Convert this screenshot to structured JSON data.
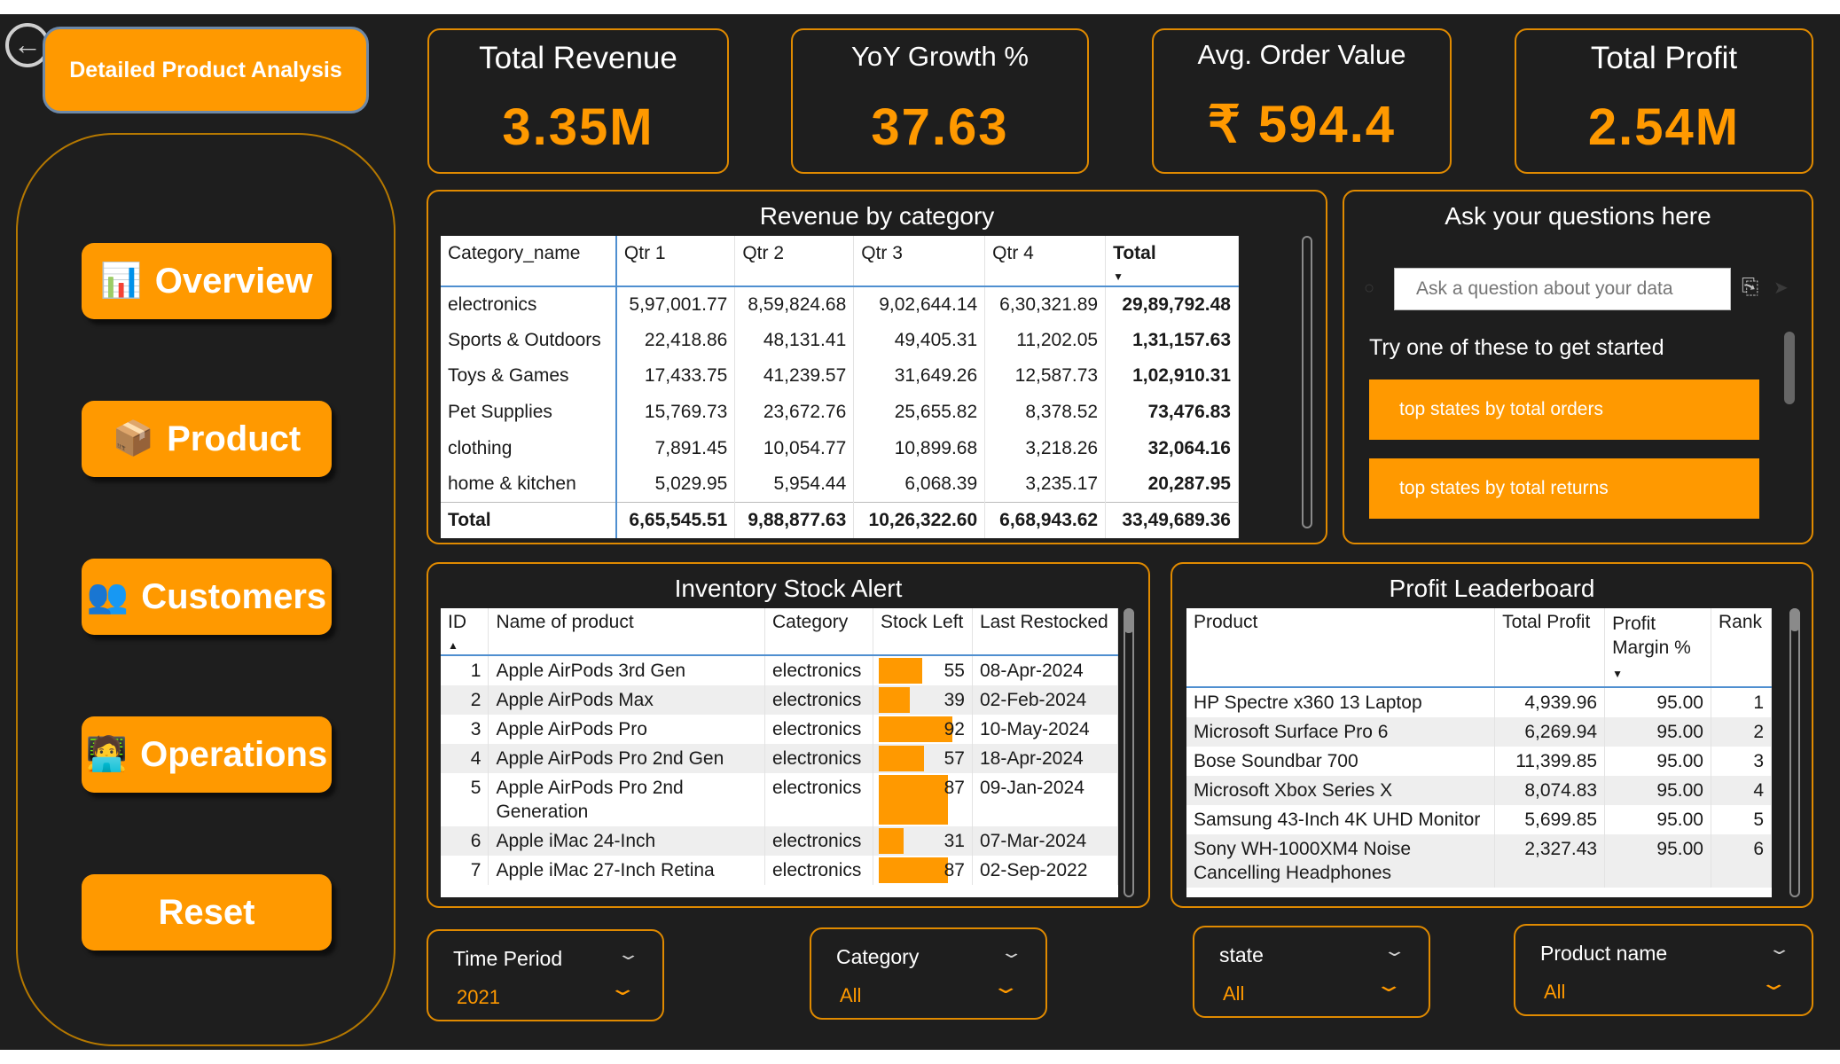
{
  "nav": {
    "title": "Detailed Product Analysis",
    "items": [
      {
        "label": "Overview",
        "icon": "📊"
      },
      {
        "label": "Product",
        "icon": "📦"
      },
      {
        "label": "Customers",
        "icon": "👥"
      },
      {
        "label": "Operations",
        "icon": "🧑‍💻"
      },
      {
        "label": "Reset",
        "icon": ""
      }
    ]
  },
  "kpis": [
    {
      "title": "Total Revenue",
      "value": "3.35M"
    },
    {
      "title": "YoY Growth %",
      "value": "37.63"
    },
    {
      "title": "Avg. Order Value",
      "value": "₹ 594.4"
    },
    {
      "title": "Total Profit",
      "value": "2.54M"
    }
  ],
  "revenue": {
    "title": "Revenue by category",
    "headers": [
      "Category_name",
      "Qtr 1",
      "Qtr 2",
      "Qtr 3",
      "Qtr 4",
      "Total"
    ],
    "rows": [
      [
        "electronics",
        "5,97,001.77",
        "8,59,824.68",
        "9,02,644.14",
        "6,30,321.89",
        "29,89,792.48"
      ],
      [
        "Sports & Outdoors",
        "22,418.86",
        "48,131.41",
        "49,405.31",
        "11,202.05",
        "1,31,157.63"
      ],
      [
        "Toys & Games",
        "17,433.75",
        "41,239.57",
        "31,649.26",
        "12,587.73",
        "1,02,910.31"
      ],
      [
        "Pet Supplies",
        "15,769.73",
        "23,672.76",
        "25,655.82",
        "8,378.52",
        "73,476.83"
      ],
      [
        "clothing",
        "7,891.45",
        "10,054.77",
        "10,899.68",
        "3,218.26",
        "32,064.16"
      ],
      [
        "home & kitchen",
        "5,029.95",
        "5,954.44",
        "6,068.39",
        "3,235.17",
        "20,287.95"
      ]
    ],
    "total_row": [
      "Total",
      "6,65,545.51",
      "9,88,877.63",
      "10,26,322.60",
      "6,68,943.62",
      "33,49,689.36"
    ]
  },
  "qa": {
    "title": "Ask your questions here",
    "placeholder": "Ask a question about your data",
    "prompt": "Try one of these to get started",
    "suggestions": [
      "top states by total orders",
      "top states by total returns"
    ]
  },
  "inventory": {
    "title": "Inventory Stock Alert",
    "headers": [
      "ID",
      "Name of product",
      "Category",
      "Stock Left",
      "Last Restocked"
    ],
    "rows": [
      {
        "id": "1",
        "name": "Apple AirPods 3rd Gen",
        "category": "electronics",
        "stock": 55,
        "date": "08-Apr-2024"
      },
      {
        "id": "2",
        "name": "Apple AirPods Max",
        "category": "electronics",
        "stock": 39,
        "date": "02-Feb-2024"
      },
      {
        "id": "3",
        "name": "Apple AirPods Pro",
        "category": "electronics",
        "stock": 92,
        "date": "10-May-2024"
      },
      {
        "id": "4",
        "name": "Apple AirPods Pro 2nd Gen",
        "category": "electronics",
        "stock": 57,
        "date": "18-Apr-2024"
      },
      {
        "id": "5",
        "name": "Apple AirPods Pro 2nd Generation",
        "category": "electronics",
        "stock": 87,
        "date": "09-Jan-2024"
      },
      {
        "id": "6",
        "name": "Apple iMac 24-Inch",
        "category": "electronics",
        "stock": 31,
        "date": "07-Mar-2024"
      },
      {
        "id": "7",
        "name": "Apple iMac 27-Inch Retina",
        "category": "electronics",
        "stock": 87,
        "date": "02-Sep-2022"
      }
    ]
  },
  "leaderboard": {
    "title": "Profit Leaderboard",
    "headers": [
      "Product",
      "Total Profit",
      "Profit Margin %",
      "Rank"
    ],
    "rows": [
      [
        "HP Spectre x360 13 Laptop",
        "4,939.96",
        "95.00",
        "1"
      ],
      [
        "Microsoft Surface Pro 6",
        "6,269.94",
        "95.00",
        "2"
      ],
      [
        "Bose Soundbar 700",
        "11,399.85",
        "95.00",
        "3"
      ],
      [
        "Microsoft Xbox Series X",
        "8,074.83",
        "95.00",
        "4"
      ],
      [
        "Samsung 43-Inch 4K UHD Monitor",
        "5,699.85",
        "95.00",
        "5"
      ],
      [
        "Sony WH-1000XM4 Noise Cancelling Headphones",
        "2,327.43",
        "95.00",
        "6"
      ]
    ]
  },
  "filters": [
    {
      "label": "Time Period",
      "value": "2021"
    },
    {
      "label": "Category",
      "value": "All"
    },
    {
      "label": "state",
      "value": "All"
    },
    {
      "label": "Product name",
      "value": "All"
    }
  ],
  "colors": {
    "accent": "#ff9900",
    "background": "#1e1e1e",
    "border": "#e08a00"
  }
}
